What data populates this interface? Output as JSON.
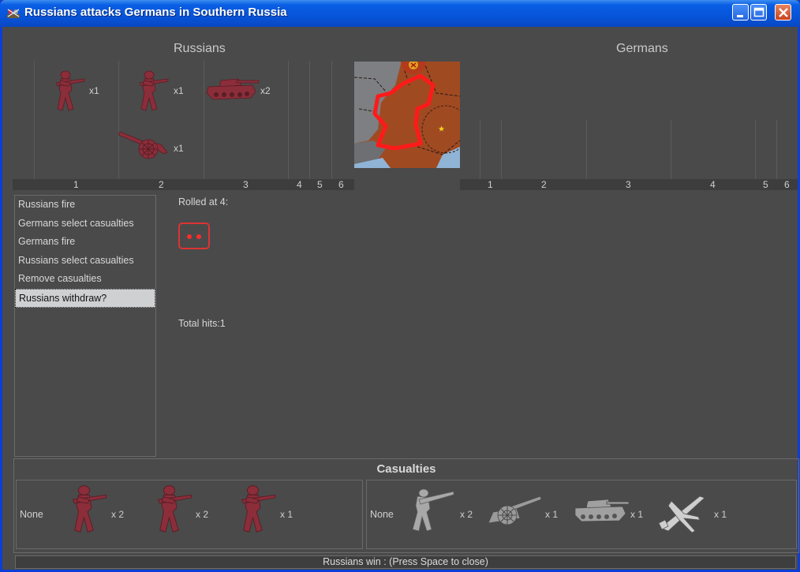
{
  "window": {
    "title": "Russians attacks Germans in Southern Russia"
  },
  "colors": {
    "russian_unit": "#8b2e3a",
    "german_unit": "#9a9a9a",
    "die_pip": "#ff2b2b",
    "title_bar": "#0654d9"
  },
  "sides": {
    "attacker": "Russians",
    "defender": "Germans"
  },
  "columns": {
    "attacker": [
      "1",
      "2",
      "3",
      "4",
      "5",
      "6"
    ],
    "defender": [
      "1",
      "2",
      "3",
      "4",
      "5",
      "6"
    ]
  },
  "attacker_units": [
    {
      "type": "infantry-icon",
      "count": "x1"
    },
    {
      "type": "infantry-icon",
      "count": "x1"
    },
    {
      "type": "tank-icon",
      "count": "x2"
    },
    {
      "type": "artillery-icon",
      "count": "x1"
    }
  ],
  "phases": [
    "Russians fire",
    "Germans select casualties",
    "Germans fire",
    "Russians select casualties",
    "Remove casualties",
    "Russians withdraw?"
  ],
  "selected_phase": "Russians withdraw?",
  "dice": {
    "label": "Rolled at 4:",
    "value": 2,
    "total_label": "Total hits:1"
  },
  "casualties": {
    "title": "Casualties",
    "russian": {
      "none_label": "None",
      "units": [
        {
          "type": "infantry-icon",
          "count": "x 2"
        },
        {
          "type": "infantry-icon",
          "count": "x 2"
        },
        {
          "type": "infantry-icon",
          "count": "x 1"
        }
      ]
    },
    "german": {
      "none_label": "None",
      "units": [
        {
          "type": "infantry-icon",
          "count": "x 2"
        },
        {
          "type": "artillery-icon",
          "count": "x 1"
        },
        {
          "type": "tank-icon",
          "count": "x 1"
        },
        {
          "type": "fighter-plane-icon",
          "count": "x 1"
        }
      ]
    }
  },
  "status": "Russians win : (Press Space to close)"
}
